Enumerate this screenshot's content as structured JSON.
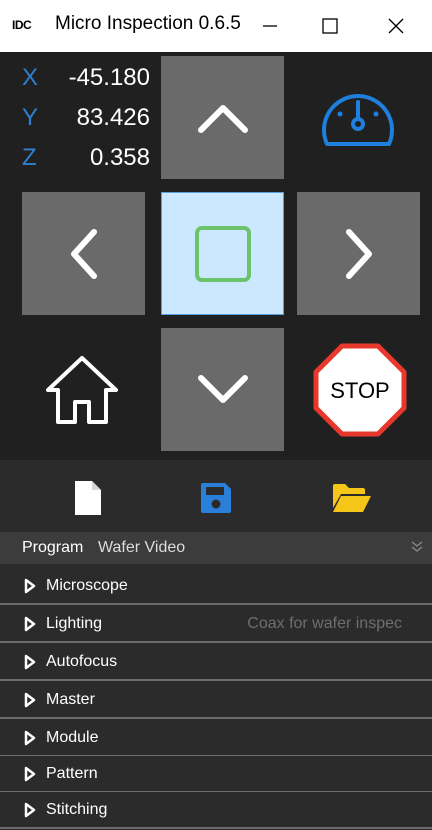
{
  "window": {
    "logo_text": "IDC",
    "title": "Micro Inspection 0.6.5",
    "minimize_glyph": "—",
    "maximize_glyph": "☐",
    "close_glyph": "✕"
  },
  "position": {
    "x_label": "X",
    "x_value": "-45.180",
    "y_label": "Y",
    "y_value": "83.426",
    "z_label": "Z",
    "z_value": "0.358"
  },
  "jog": {
    "up_icon": "chevron-up-icon",
    "down_icon": "chevron-down-icon",
    "left_icon": "chevron-left-icon",
    "right_icon": "chevron-right-icon",
    "center_icon": "square-icon",
    "speed_icon": "speedometer-icon",
    "home_icon": "home-icon",
    "stop_label": "STOP"
  },
  "colors": {
    "axis_blue": "#2f7fd4",
    "speed_blue": "#1e7fdc",
    "stop_red": "#e8372c",
    "save_blue": "#2a7fd8",
    "folder_yellow": "#f5c518",
    "center_fill": "#cce8ff",
    "center_square": "#6bc46b"
  },
  "file": {
    "new_icon": "new-file-icon",
    "save_icon": "save-icon",
    "open_icon": "open-folder-icon"
  },
  "program": {
    "label": "Program",
    "name": "Wafer Video",
    "chevron_icon": "double-chevron-down-icon"
  },
  "sections": [
    {
      "label": "Microscope",
      "value": ""
    },
    {
      "label": "Lighting",
      "value": "Coax for wafer inspec"
    },
    {
      "label": "Autofocus",
      "value": ""
    },
    {
      "label": "Master",
      "value": ""
    },
    {
      "label": "Module",
      "value": ""
    },
    {
      "label": "Pattern",
      "value": ""
    },
    {
      "label": "Stitching",
      "value": ""
    }
  ]
}
